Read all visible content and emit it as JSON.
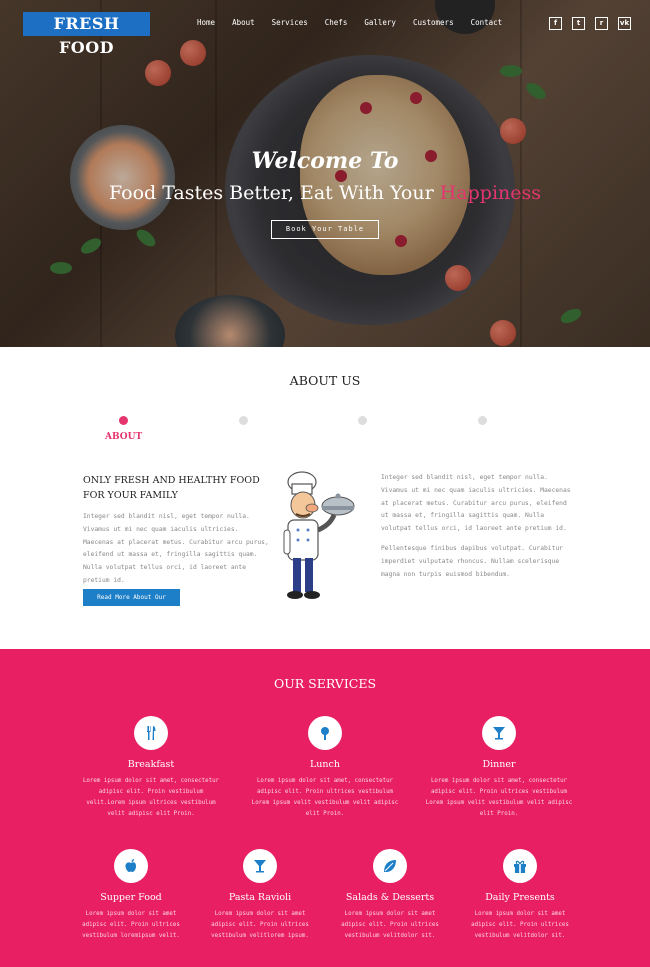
{
  "header": {
    "logo": "FRESH  FOOD",
    "nav": [
      "Home",
      "About",
      "Services",
      "Chefs",
      "Gallery",
      "Customers",
      "Contact"
    ],
    "social": [
      {
        "icon": "facebook-icon",
        "glyph": "f"
      },
      {
        "icon": "twitter-icon",
        "glyph": "t"
      },
      {
        "icon": "rss-icon",
        "glyph": "r"
      },
      {
        "icon": "vk-icon",
        "glyph": "vk"
      }
    ]
  },
  "hero": {
    "title_line1": "Welcome To",
    "title_line2_main": "Food Tastes Better, Eat With Your ",
    "title_line2_accent": "Happiness",
    "button": "Book Your Table"
  },
  "about": {
    "title": "ABOUT US",
    "active_tab": "ABOUT",
    "heading": "ONLY FRESH AND HEALTHY FOOD FOR YOUR FAMILY",
    "text": "Integer sed blandit nisl, eget tempor nulla. Vivamus ut mi nec quam iaculis ultricies. Maecenas at placerat metus. Curabitur arcu purus, eleifend ut massa et, fringilla sagittis quam. Nulla volutpat tellus orci, id laoreet ante pretium id.",
    "button": "Read More About Our Recipes",
    "right_p1": "Integer sed blandit nisl, eget tempor nulla. Vivamus ut mi nec quam iaculis ultricies. Maecenas at placerat metus. Curabitur arcu purus, eleifend ut massa et, fringilla sagittis quam. Nulla volutpat tellus orci, id laoreet ante pretium id.",
    "right_p2": "Pellentesque finibus dapibus volutpat. Curabitur imperdiet vulputate rhoncus. Nullam scelerisque magna non turpis euismod bibendum."
  },
  "services": {
    "title": "OUR SERVICES",
    "row1": [
      {
        "name": "Breakfast",
        "icon": "cutlery-icon",
        "desc": "Lorem ipsum dolor sit amet, consectetur adipisc elit. Proin vestibulum velit.Lorem ipsum ultrices vestibulum velit adipisc elit Proin."
      },
      {
        "name": "Lunch",
        "icon": "drumstick-icon",
        "desc": "Lorem ipsum dolor sit amet, consectetur adipisc elit. Proin ultrices vestibulum Lorem ipsum velit vestibulum velit adipisc elit Proin."
      },
      {
        "name": "Dinner",
        "icon": "cocktail-icon",
        "desc": "Lorem ipsum dolor sit amet, consectetur adipisc elit. Proin ultrices vestibulum Lorem ipsum velit vestibulum velit adipisc elit Proin."
      }
    ],
    "row2": [
      {
        "name": "Supper Food",
        "icon": "apple-icon",
        "desc": "Lorem ipsum dolor sit amet adipisc elit. Proin ultrices vestibulum loremipsum velit."
      },
      {
        "name": "Pasta Ravioli",
        "icon": "glass-icon",
        "desc": "Lorem ipsum dolor sit amet adipisc elit. Proin ultrices vestibulum velitlorem ipsum."
      },
      {
        "name": "Salads & Desserts",
        "icon": "leaf-icon",
        "desc": "Lorem ipsum dolor sit amet adipisc elit. Proin ultrices vestibulum velitdolor sit."
      },
      {
        "name": "Daily Presents",
        "icon": "gift-icon",
        "desc": "Lorem ipsum dolor sit amet adipisc elit. Proin ultrices vestibulum velitdolor sit."
      }
    ]
  },
  "colors": {
    "accent": "#e91f63",
    "accent_text": "#e5356e",
    "brand_blue": "#1d6fc4"
  }
}
